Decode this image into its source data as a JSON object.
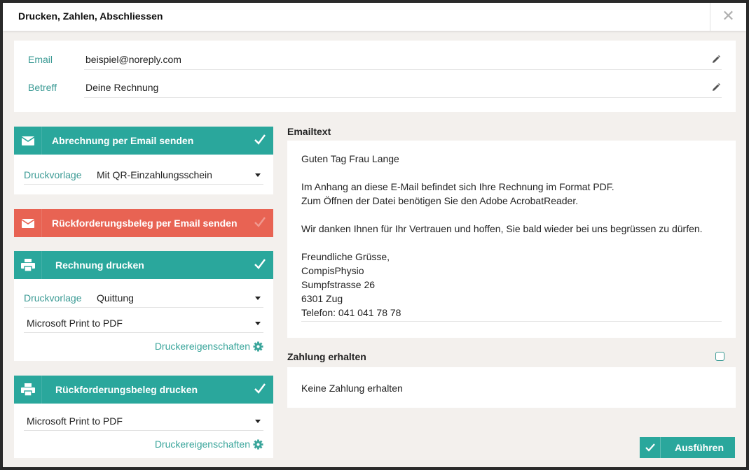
{
  "dialog": {
    "title": "Drucken, Zahlen, Abschliessen"
  },
  "mail": {
    "email_label": "Email",
    "email_value": "beispiel@noreply.com",
    "subject_label": "Betreff",
    "subject_value": "Deine Rechnung"
  },
  "panels": {
    "invoice_email": {
      "label": "Abrechnung per Email senden",
      "template_label": "Druckvorlage",
      "template_value": "Mit QR-Einzahlungsschein",
      "checked": true
    },
    "refund_email": {
      "label": "Rückforderungsbeleg per Email senden",
      "checked": false
    },
    "invoice_print": {
      "label": "Rechnung drucken",
      "template_label": "Druckvorlage",
      "template_value": "Quittung",
      "printer_value": "Microsoft Print to PDF",
      "props_label": "Druckereigenschaften",
      "checked": true
    },
    "refund_print": {
      "label": "Rückforderungsbeleg drucken",
      "printer_value": "Microsoft Print to PDF",
      "props_label": "Druckereigenschaften",
      "checked": true
    }
  },
  "email_text": {
    "title": "Emailtext",
    "body": "Guten Tag Frau Lange\n\nIm Anhang an diese E-Mail befindet sich Ihre Rechnung im Format PDF.\nZum Öffnen der Datei benötigen Sie den Adobe AcrobatReader.\n\nWir danken Ihnen für Ihr Vertrauen und hoffen, Sie bald wieder bei uns begrüssen zu dürfen.\n\nFreundliche Grüsse,\nCompisPhysio\nSumpfstrasse 26\n6301 Zug\nTelefon: 041 041 78 78"
  },
  "payment": {
    "title": "Zahlung erhalten",
    "status": "Keine Zahlung erhalten",
    "checked": false
  },
  "actions": {
    "execute_label": "Ausführen"
  },
  "colors": {
    "teal": "#2aa79c",
    "red": "#e86353",
    "label_teal": "#3a9a94"
  },
  "icons": {
    "close": "close-icon",
    "edit": "pencil-icon",
    "mail": "envelope-icon",
    "print": "printer-icon",
    "check": "checkmark-icon",
    "settings": "gear-icon"
  }
}
